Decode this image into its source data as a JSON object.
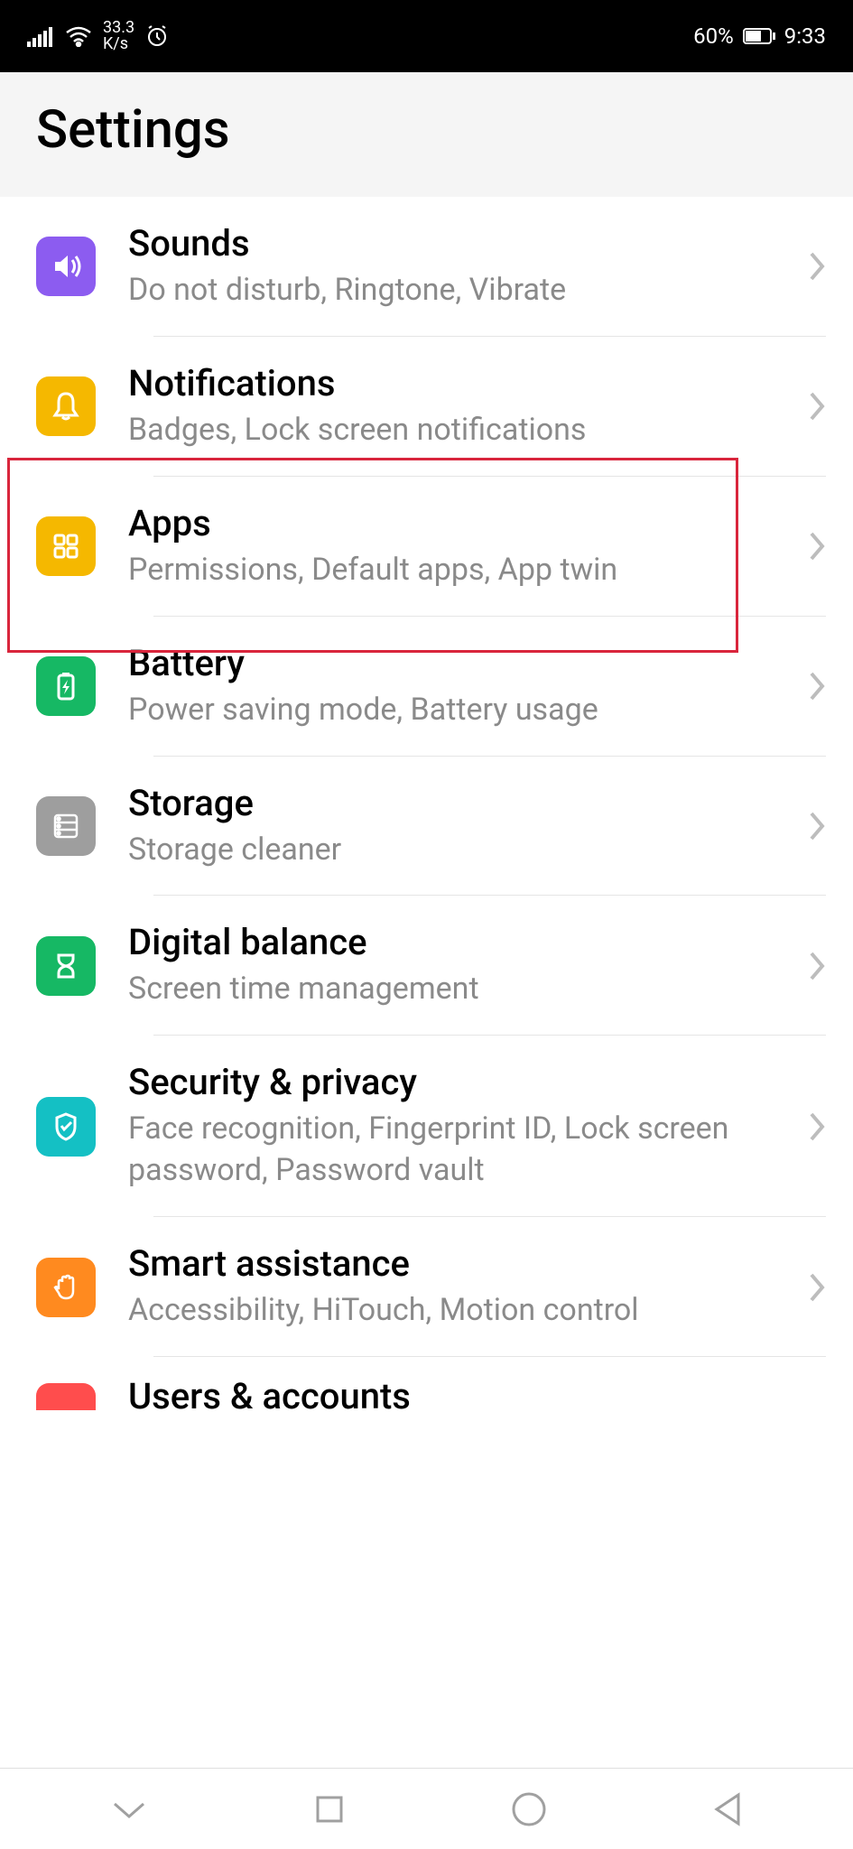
{
  "statusBar": {
    "netSpeedTop": "33.3",
    "netSpeedBottom": "K/s",
    "batteryPercent": "60%",
    "time": "9:33"
  },
  "header": {
    "title": "Settings"
  },
  "items": [
    {
      "title": "Sounds",
      "subtitle": "Do not disturb, Ringtone, Vibrate",
      "iconColor": "purple",
      "iconType": "sound"
    },
    {
      "title": "Notifications",
      "subtitle": "Badges, Lock screen notifications",
      "iconColor": "yellow",
      "iconType": "bell"
    },
    {
      "title": "Apps",
      "subtitle": "Permissions, Default apps, App twin",
      "iconColor": "yellow",
      "iconType": "apps"
    },
    {
      "title": "Battery",
      "subtitle": "Power saving mode, Battery usage",
      "iconColor": "green",
      "iconType": "battery"
    },
    {
      "title": "Storage",
      "subtitle": "Storage cleaner",
      "iconColor": "gray",
      "iconType": "storage"
    },
    {
      "title": "Digital balance",
      "subtitle": "Screen time management",
      "iconColor": "green",
      "iconType": "hourglass"
    },
    {
      "title": "Security & privacy",
      "subtitle": "Face recognition, Fingerprint ID, Lock screen password, Password vault",
      "iconColor": "teal",
      "iconType": "shield"
    },
    {
      "title": "Smart assistance",
      "subtitle": "Accessibility, HiTouch, Motion control",
      "iconColor": "orange",
      "iconType": "hand"
    }
  ],
  "partialItem": {
    "title": "Users & accounts",
    "iconColor": "red"
  },
  "highlightedIndex": 2
}
